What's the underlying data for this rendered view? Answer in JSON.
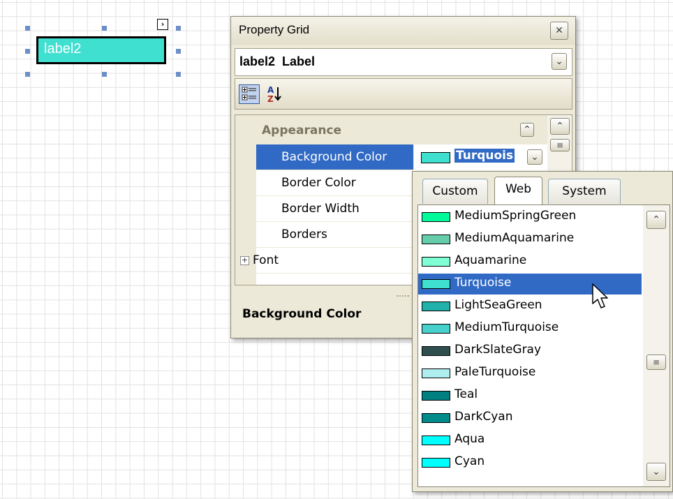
{
  "design_surface": {
    "label_text": "label2",
    "smart_tag_glyph": "›",
    "label_color": "#40e0d0"
  },
  "property_grid": {
    "title": "Property Grid",
    "close_glyph": "✕",
    "selector": {
      "name": "label2",
      "type": "Label",
      "dropdown_glyph": "⌄"
    },
    "toolbar": {
      "categorized_icon": "categorized-icon",
      "alphabetical_icon": "sort-alphabetical-icon"
    },
    "category": {
      "label": "Appearance",
      "collapse_glyph": "⌃"
    },
    "properties": [
      {
        "name": "Background Color",
        "selected": true,
        "value": "Turquois"
      },
      {
        "name": "Border Color"
      },
      {
        "name": "Border Width"
      },
      {
        "name": "Borders"
      },
      {
        "name": "Font",
        "expandable": true,
        "expand_glyph": "+"
      }
    ],
    "scroll": {
      "up_glyph": "⌃",
      "thumb_glyph": "≡"
    },
    "description": "Background Color"
  },
  "color_picker": {
    "tabs": [
      {
        "label": "Custom",
        "active": false
      },
      {
        "label": "Web",
        "active": true
      },
      {
        "label": "System",
        "active": false
      }
    ],
    "colors": [
      {
        "name": "MediumSpringGreen",
        "hex": "#00fa9a"
      },
      {
        "name": "MediumAquamarine",
        "hex": "#66cdaa"
      },
      {
        "name": "Aquamarine",
        "hex": "#7fffd4"
      },
      {
        "name": "Turquoise",
        "hex": "#40e0d0",
        "selected": true
      },
      {
        "name": "LightSeaGreen",
        "hex": "#20b2aa"
      },
      {
        "name": "MediumTurquoise",
        "hex": "#48d1cc"
      },
      {
        "name": "DarkSlateGray",
        "hex": "#2f4f4f"
      },
      {
        "name": "PaleTurquoise",
        "hex": "#afeeee"
      },
      {
        "name": "Teal",
        "hex": "#008080"
      },
      {
        "name": "DarkCyan",
        "hex": "#008b8b"
      },
      {
        "name": "Aqua",
        "hex": "#00ffff"
      },
      {
        "name": "Cyan",
        "hex": "#00ffff"
      }
    ],
    "scroll": {
      "up_glyph": "⌃",
      "thumb_glyph": "≡",
      "down_glyph": "⌄"
    }
  },
  "colors": {
    "selection": "#316ac5",
    "window_bg": "#ece9d8",
    "handle": "#6b8fc6"
  }
}
